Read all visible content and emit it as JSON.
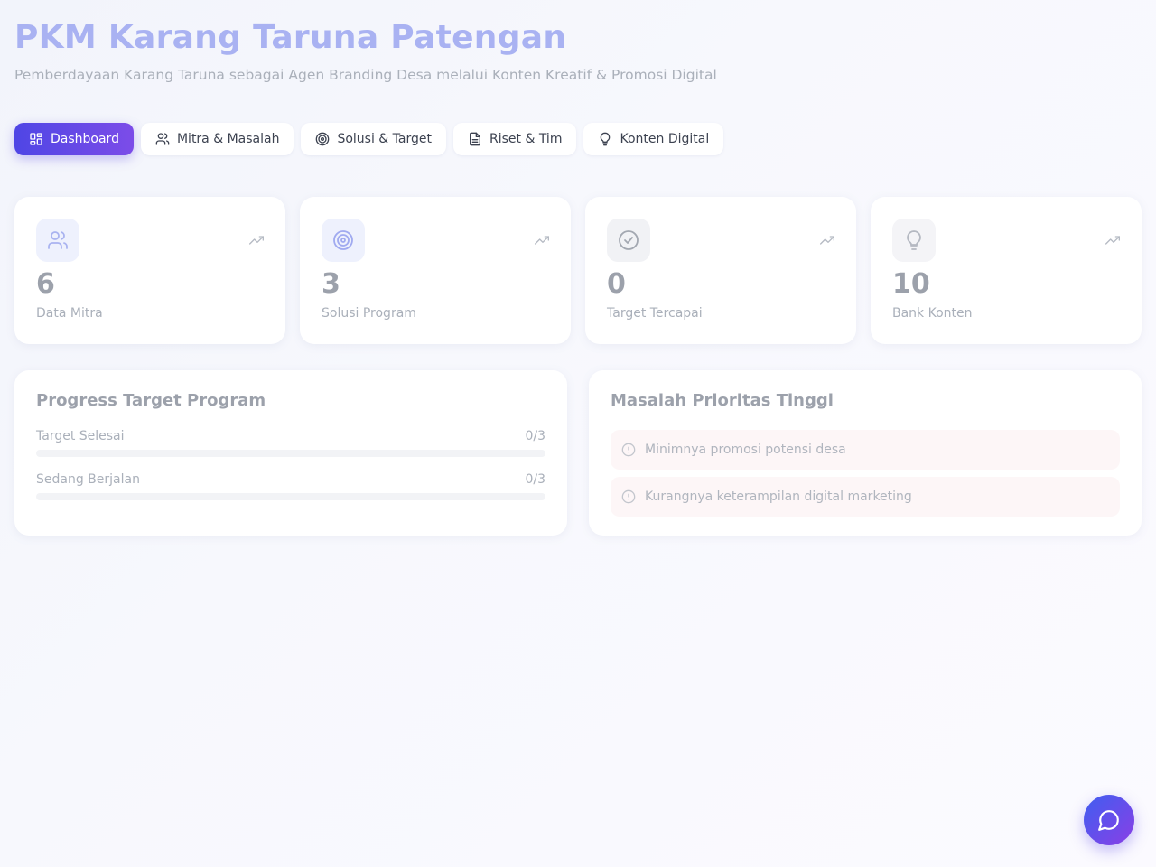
{
  "header": {
    "title": "PKM Karang Taruna Patengan",
    "subtitle": "Pemberdayaan Karang Taruna sebagai Agen Branding Desa melalui Konten Kreatif & Promosi Digital"
  },
  "tabs": [
    {
      "label": "Dashboard",
      "icon": "grid-icon",
      "active": true
    },
    {
      "label": "Mitra & Masalah",
      "icon": "users-icon",
      "active": false
    },
    {
      "label": "Solusi & Target",
      "icon": "target-icon",
      "active": false
    },
    {
      "label": "Riset & Tim",
      "icon": "document-icon",
      "active": false
    },
    {
      "label": "Konten Digital",
      "icon": "lightbulb-icon",
      "active": false
    }
  ],
  "stats": [
    {
      "value": "6",
      "label": "Data Mitra",
      "icon": "users-icon",
      "trend_icon": "trending-up-icon"
    },
    {
      "value": "3",
      "label": "Solusi Program",
      "icon": "target-icon",
      "trend_icon": "trending-up-icon"
    },
    {
      "value": "0",
      "label": "Target Tercapai",
      "icon": "check-circle-icon",
      "trend_icon": "trending-up-icon"
    },
    {
      "value": "10",
      "label": "Bank Konten",
      "icon": "lightbulb-icon",
      "trend_icon": "trending-up-icon"
    }
  ],
  "progress_panel": {
    "title": "Progress Target Program",
    "rows": [
      {
        "label": "Target Selesai",
        "count": "0/3",
        "fraction": 0
      },
      {
        "label": "Sedang Berjalan",
        "count": "0/3",
        "fraction": 0
      }
    ]
  },
  "issues_panel": {
    "title": "Masalah Prioritas Tinggi",
    "items": [
      {
        "text": "Minimnya promosi potensi desa",
        "icon": "alert-circle-icon"
      },
      {
        "text": "Kurangnya keterampilan digital marketing",
        "icon": "alert-circle-icon"
      }
    ]
  },
  "chat_button": {
    "icon": "chat-bubble-icon"
  },
  "colors": {
    "accent": "#4f46e5",
    "accent_end": "#7c4ce8",
    "title": "#a9b2f2",
    "issue_bg": "#fdf6f7"
  }
}
